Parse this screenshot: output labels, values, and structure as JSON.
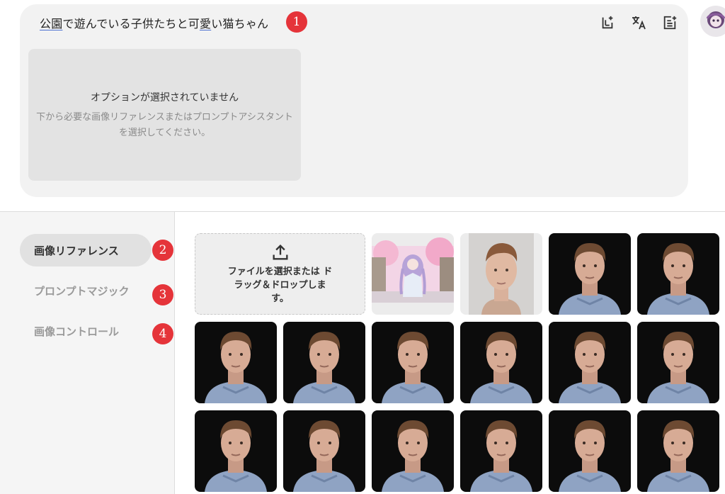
{
  "prompt": {
    "text_part1": "公園",
    "text_part2": "で遊んでいる子供たちと可",
    "text_part3": "愛",
    "text_part4": "い猫ちゃん"
  },
  "toolbar": {
    "icons": [
      "add-image-icon",
      "translate-icon",
      "add-note-icon"
    ]
  },
  "placeholder": {
    "title": "オプションが選択されていません",
    "description": "下から必要な画像リファレンスまたはプロンプトアシスタントを選択してください。"
  },
  "badges": [
    "1",
    "2",
    "3",
    "4"
  ],
  "sidebar": {
    "items": [
      {
        "label": "画像リファレンス",
        "active": true
      },
      {
        "label": "プロンプトマジック",
        "active": false
      },
      {
        "label": "画像コントロール",
        "active": false
      }
    ]
  },
  "upload": {
    "label": "ファイルを選択または ドラッグ＆ドロップします。"
  },
  "colors": {
    "badge": "#e5343a",
    "panel": "#f2f2f2",
    "active_tab": "#e1e1e1"
  }
}
